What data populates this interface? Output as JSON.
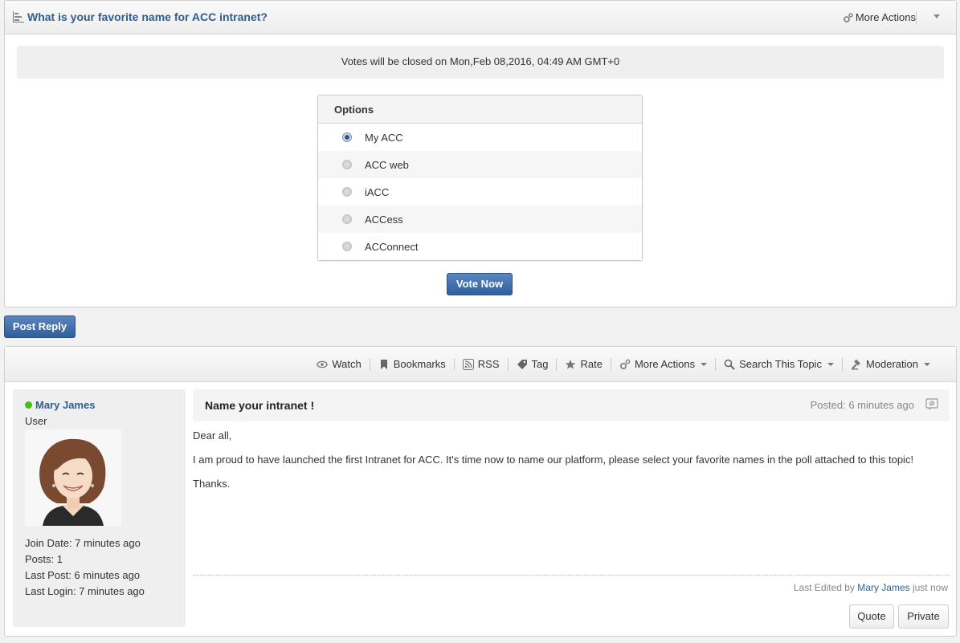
{
  "poll": {
    "title": "What is your favorite name for ACC intranet?",
    "more_actions": "More Actions",
    "close_notice": "Votes will be closed on Mon,Feb 08,2016, 04:49 AM GMT+0",
    "options_header": "Options",
    "options": [
      {
        "label": "My ACC",
        "checked": true
      },
      {
        "label": "ACC web",
        "checked": false
      },
      {
        "label": "iACC",
        "checked": false
      },
      {
        "label": "ACCess",
        "checked": false
      },
      {
        "label": "ACConnect",
        "checked": false
      }
    ],
    "vote_button": "Vote Now"
  },
  "post_reply_label": "Post Reply",
  "toolbar": {
    "watch": "Watch",
    "bookmarks": "Bookmarks",
    "rss": "RSS",
    "tag": "Tag",
    "rate": "Rate",
    "more_actions": "More Actions",
    "search_topic": "Search This Topic",
    "moderation": "Moderation"
  },
  "user": {
    "name": "Mary James",
    "role": "User",
    "stats": [
      "Join Date: 7 minutes ago",
      "Posts: 1",
      "Last Post: 6 minutes ago",
      "Last Login: 7 minutes ago"
    ]
  },
  "post": {
    "title": "Name your intranet !",
    "posted": "Posted: 6 minutes ago",
    "body": [
      "Dear all,",
      "I am proud to have launched the first Intranet for ACC. It's time now to name our platform, please select your favorite names in the poll attached to this topic!",
      "Thanks."
    ],
    "last_edited_prefix": "Last Edited by",
    "last_edited_user": "Mary James",
    "last_edited_suffix": "just now",
    "quote_button": "Quote",
    "private_button": "Private"
  },
  "colors": {
    "link": "#2f5e8e",
    "primary_button": "#3a6aa8",
    "online": "#4cbb17"
  }
}
